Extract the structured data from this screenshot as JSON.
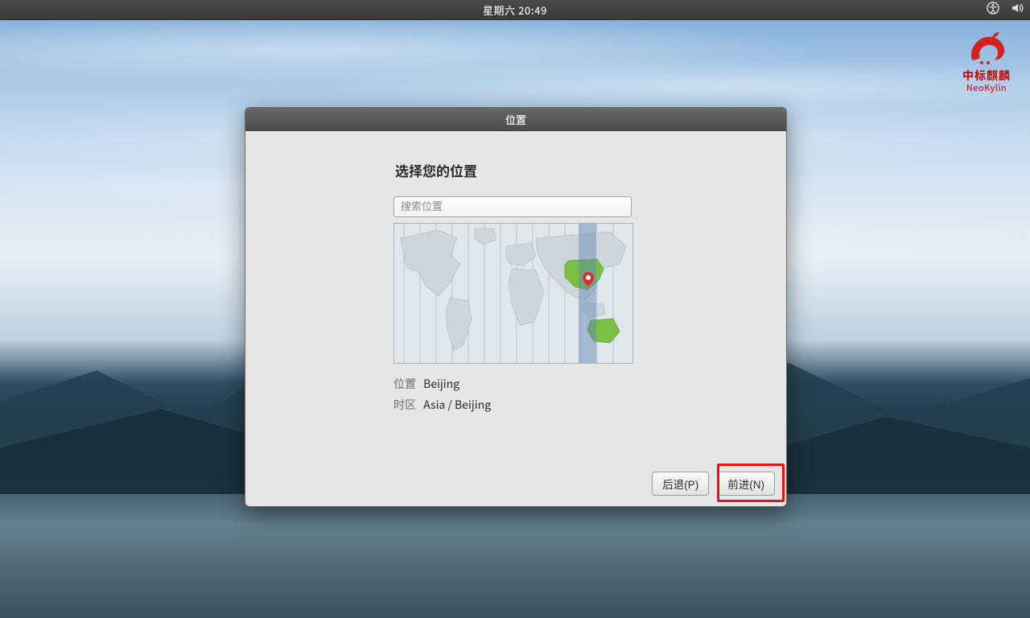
{
  "topbar": {
    "clock": "星期六 20:49"
  },
  "brand": {
    "cn": "中标麒麟",
    "en": "NeoKylin"
  },
  "dialog": {
    "title": "位置",
    "heading": "选择您的位置",
    "search_placeholder": "搜索位置",
    "location_label": "位置",
    "location_value": "Beijing",
    "timezone_label": "时区",
    "timezone_value": "Asia / Beijing",
    "back_label": "后退(P)",
    "next_label": "前进(N)"
  }
}
